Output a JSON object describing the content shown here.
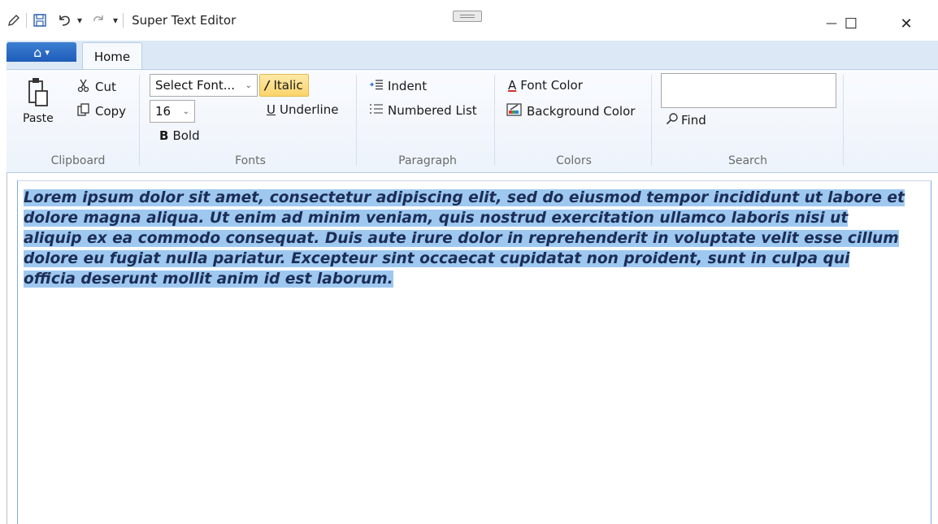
{
  "window": {
    "title": "Super Text Editor",
    "minimize_glyph": "—",
    "maximize_glyph": "☐",
    "close_glyph": "✕"
  },
  "quick_access": {
    "icons": [
      "edit-icon",
      "save-icon",
      "undo-icon",
      "redo-icon"
    ],
    "dropdown_glyph": "▾"
  },
  "tabs": {
    "app_menu_glyph": "⌂",
    "app_menu_arrow": "▾",
    "home_label": "Home"
  },
  "ribbon": {
    "clipboard": {
      "label": "Clipboard",
      "paste": "Paste",
      "cut": "Cut",
      "copy": "Copy"
    },
    "fonts": {
      "label": "Fonts",
      "font_select": "Select Font...",
      "size_select": "16",
      "bold": "Bold",
      "italic": "Italic",
      "underline": "Underline",
      "bold_glyph": "B",
      "italic_glyph": "/",
      "underline_glyph": "U"
    },
    "paragraph": {
      "label": "Paragraph",
      "indent": "Indent",
      "numbered_list": "Numbered List"
    },
    "colors": {
      "label": "Colors",
      "font_color": "Font Color",
      "background_color": "Background Color",
      "font_color_glyph": "A"
    },
    "search": {
      "label": "Search",
      "find": "Find",
      "query": ""
    }
  },
  "editor": {
    "lines": [
      "Lorem ipsum dolor sit amet, consectetur adipiscing elit, sed do eiusmod tempor incididunt ut labore et",
      "dolore magna aliqua. Ut enim ad minim veniam, quis nostrud exercitation ullamco laboris nisi ut",
      "aliquip ex ea commodo consequat. Duis aute irure dolor in reprehenderit in voluptate velit esse cillum",
      "dolore eu fugiat nulla pariatur. Excepteur sint occaecat cupidatat non proident, sunt in culpa qui",
      "officia deserunt mollit anim id est laborum. "
    ]
  },
  "colors": {
    "selection": "#9ec8f0",
    "text": "#1c2d55",
    "ribbon_tab": "#dce8f6",
    "app_menu": "#2a6bc4",
    "italic_active": "#fbd46b"
  }
}
